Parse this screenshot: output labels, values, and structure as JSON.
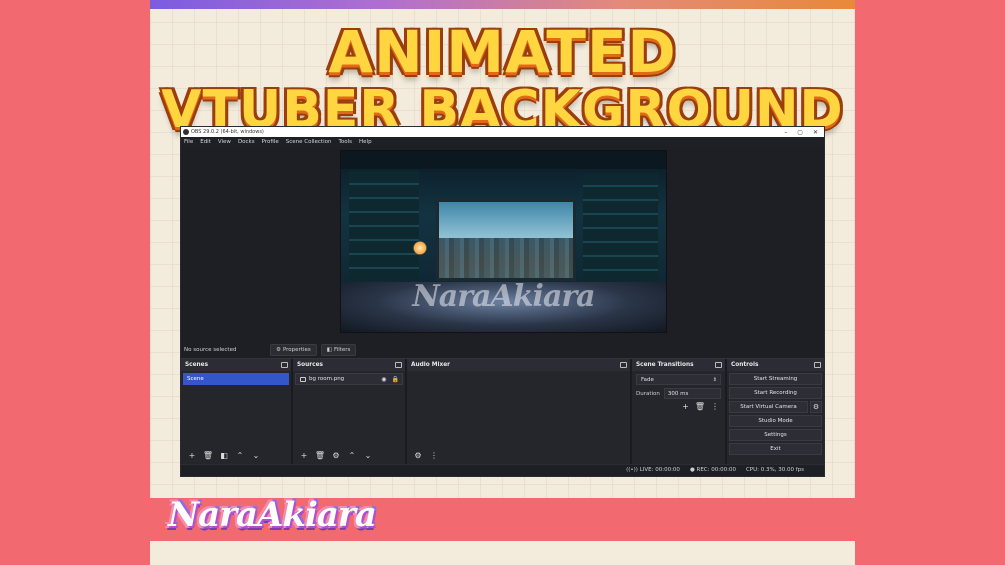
{
  "headline": {
    "line1": "ANIMATED",
    "line2": "VTUBER BACKGROUND"
  },
  "brand": "NaraAkiara",
  "obs": {
    "window_title": "OBS 29.0.2 (64-bit, windows)",
    "window_controls": [
      "–",
      "▢",
      "✕"
    ],
    "menu": [
      "File",
      "Edit",
      "View",
      "Docks",
      "Profile",
      "Scene Collection",
      "Tools",
      "Help"
    ],
    "preview": {
      "watermark": "NaraAkiara"
    },
    "source_status": "No source selected",
    "properties_label": "Properties",
    "filters_label": "Filters",
    "scenes": {
      "title": "Scenes",
      "items": [
        "Scene"
      ]
    },
    "sources": {
      "title": "Sources",
      "items": [
        "bg room.png"
      ]
    },
    "audio_mixer": {
      "title": "Audio Mixer"
    },
    "transitions": {
      "title": "Scene Transitions",
      "selected": "Fade",
      "duration_label": "Duration",
      "duration_value": "300 ms"
    },
    "controls": {
      "title": "Controls",
      "start_streaming": "Start Streaming",
      "start_recording": "Start Recording",
      "start_virtual_camera": "Start Virtual Camera",
      "studio_mode": "Studio Mode",
      "settings": "Settings",
      "exit": "Exit"
    },
    "status": {
      "live": "LIVE: 00:00:00",
      "rec": "REC: 00:00:00",
      "cpu": "CPU: 0.3%, 30.00 fps"
    }
  },
  "colors": {
    "background": "#f26a6f",
    "card": "#f3ebdc",
    "headline": "#ffd640",
    "obs_dark": "#1e1f25",
    "selection": "#3556c9"
  }
}
